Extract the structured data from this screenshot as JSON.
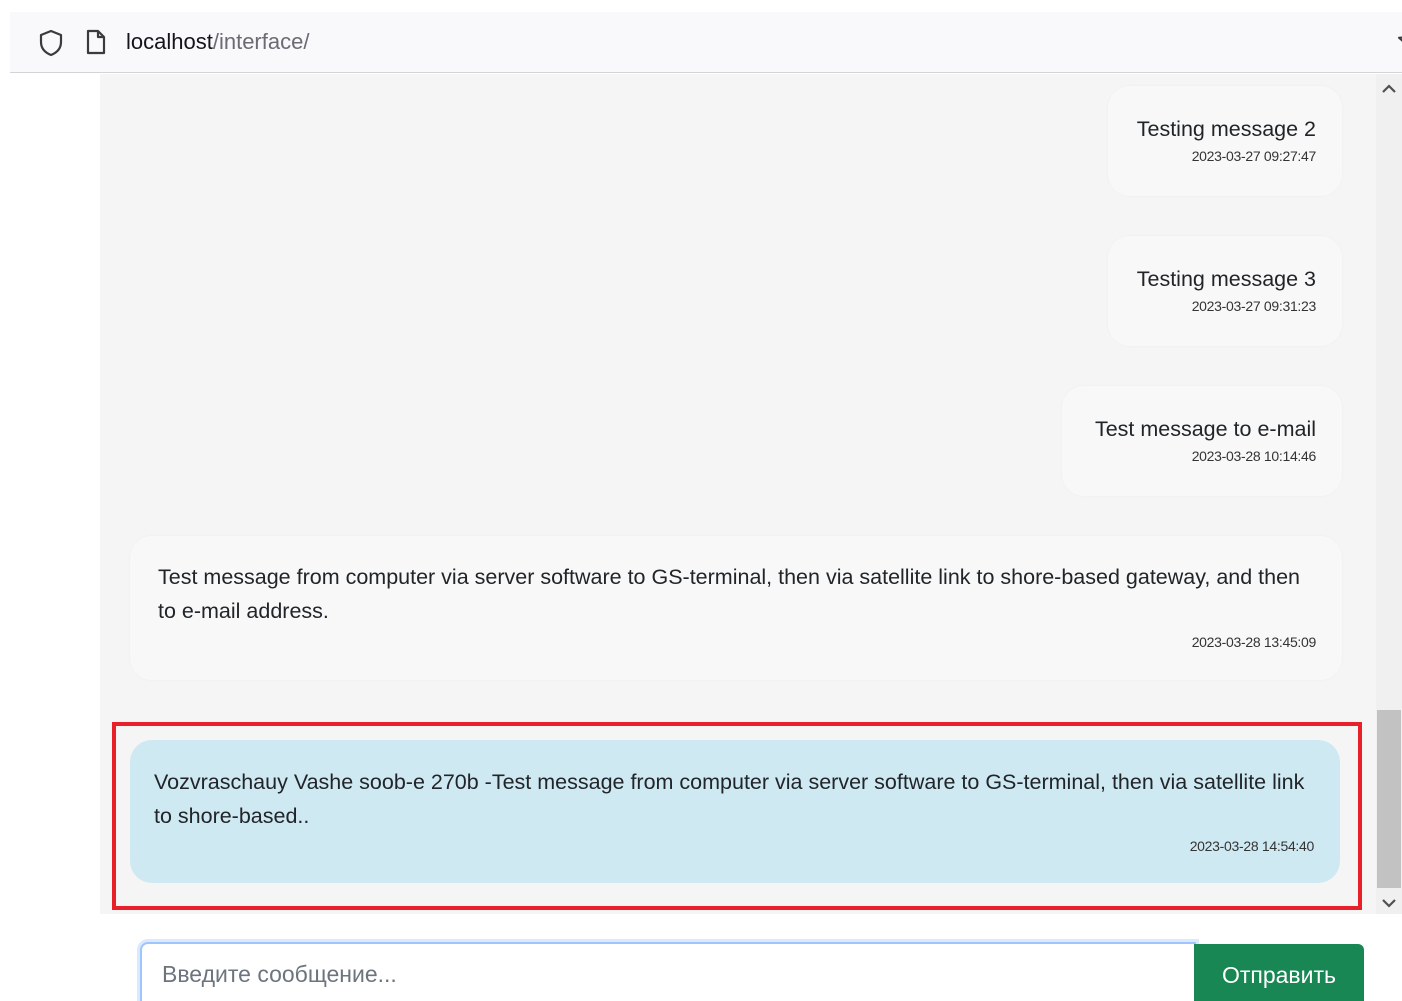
{
  "browser": {
    "url_host": "localhost",
    "url_path": "/interface/"
  },
  "messages": [
    {
      "text": "Testing message 2",
      "time": "2023-03-27 09:27:47"
    },
    {
      "text": "Testing message 3",
      "time": "2023-03-27 09:31:23"
    },
    {
      "text": "Test message to e-mail",
      "time": "2023-03-28 10:14:46"
    },
    {
      "text": "Test message from computer via server software to GS-terminal, then via satellite link to shore-based gateway, and then to e-mail address.",
      "time": "2023-03-28 13:45:09"
    }
  ],
  "reply": {
    "text": "Vozvraschauy Vashe soob-e 270b -Test message from computer via server software to GS-terminal, then via satellite link to shore-based..",
    "time": "2023-03-28 14:54:40",
    "background": "#cfe9f3"
  },
  "highlight_color": "#e8202a",
  "composer": {
    "placeholder": "Введите сообщение...",
    "send_label": "Отправить",
    "send_color": "#198754"
  }
}
